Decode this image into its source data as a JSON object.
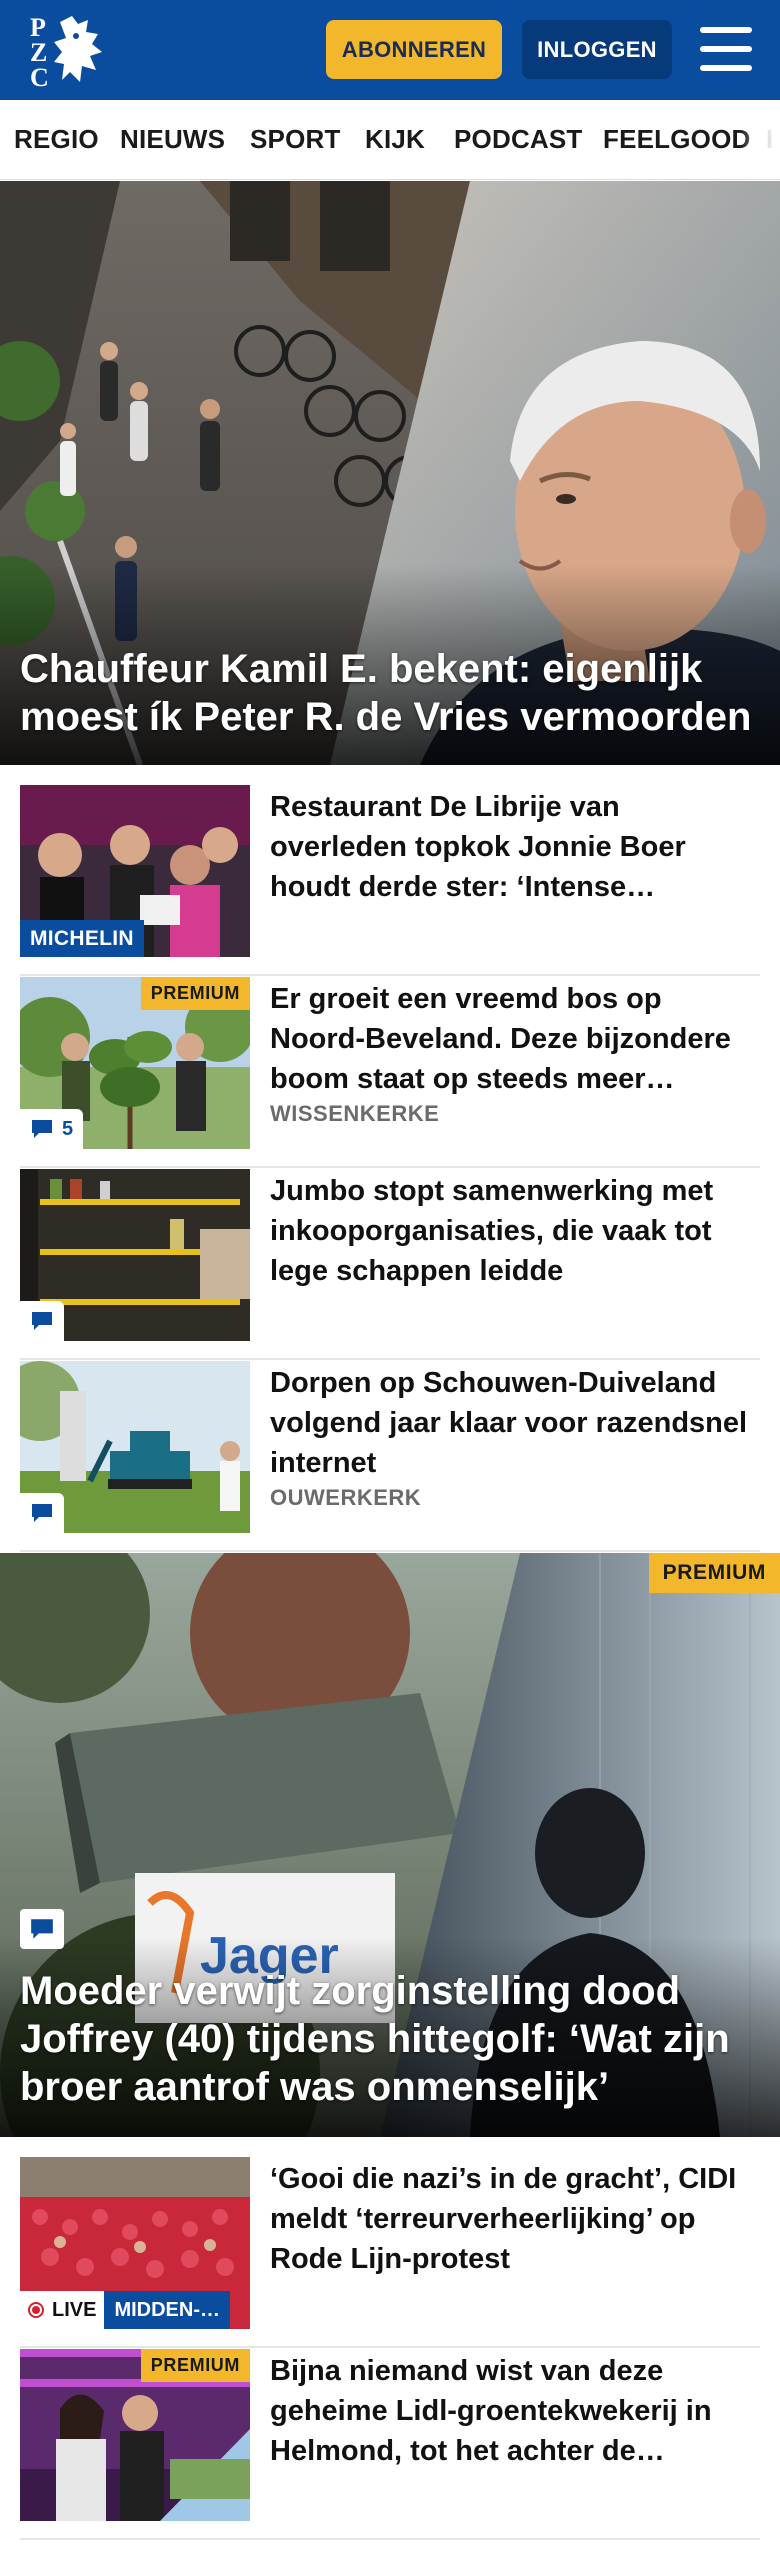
{
  "header": {
    "logo_text": "PZC",
    "subscribe_label": "ABONNEREN",
    "login_label": "INLOGGEN",
    "menu_icon": "hamburger-icon",
    "brand_color": "#0a4d9e",
    "accent_color": "#f2b72b"
  },
  "nav": {
    "items": [
      "REGIO",
      "NIEUWS",
      "SPORT",
      "KIJK",
      "PODCAST",
      "FEELGOOD",
      "I"
    ]
  },
  "hero1": {
    "headline": "Chauffeur Kamil E. bekent: eigenlijk moest ík Peter R. de Vries vermoorden"
  },
  "articles": [
    {
      "title": "Restaurant De Librije van overleden topkok Jonnie Boer houdt derde ster: ‘Intense…",
      "tag": "MICHELIN"
    },
    {
      "title": "Er groeit een vreemd bos op Noord-Beveland. Deze bijzondere boom staat op steeds meer…",
      "kicker": "WISSENKERKE",
      "premium": "PREMIUM",
      "comments": "5"
    },
    {
      "title": "Jumbo stopt samenwerking met inkooporganisaties, die vaak tot lege schappen leidde",
      "comments": ""
    },
    {
      "title": "Dorpen op Schouwen-Duiveland volgend jaar klaar voor razendsnel internet",
      "kicker": "OUWERKERK",
      "comments": ""
    }
  ],
  "hero2": {
    "headline": "Moeder verwijt zorginstelling dood Joffrey (40) tijdens hittegolf: ‘Wat zijn broer aantrof was onmenselijk’",
    "premium": "PREMIUM",
    "sign_text": "Jager"
  },
  "articles2": [
    {
      "title": "‘Gooi die nazi’s in de gracht’, CIDI meldt ‘terreurverheerlijking’ op Rode Lijn-protest",
      "live": "LIVE",
      "region": "MIDDEN-…"
    },
    {
      "title": "Bijna niemand wist van deze geheime Lidl-groentekwekerij in Helmond, tot het achter de…",
      "premium": "PREMIUM"
    }
  ]
}
